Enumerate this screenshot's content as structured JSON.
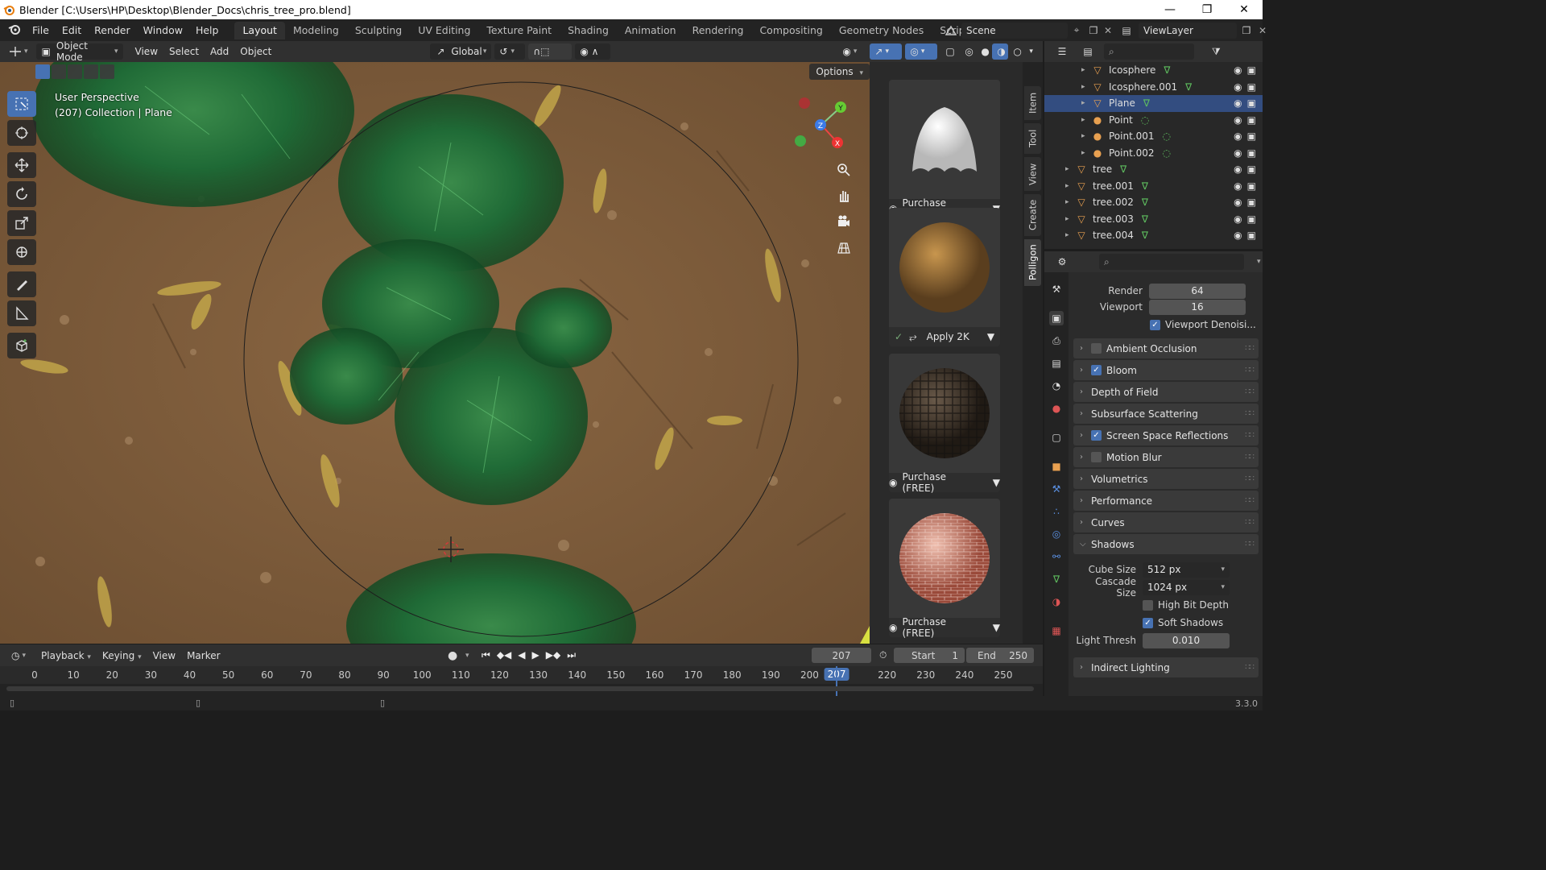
{
  "titlebar": {
    "title": "Blender [C:\\Users\\HP\\Desktop\\Blender_Docs\\chris_tree_pro.blend]",
    "minimize": "—",
    "maximize": "❐",
    "close": "✕"
  },
  "menu": [
    "File",
    "Edit",
    "Render",
    "Window",
    "Help"
  ],
  "workspaces": [
    "Layout",
    "Modeling",
    "Sculpting",
    "UV Editing",
    "Texture Paint",
    "Shading",
    "Animation",
    "Rendering",
    "Compositing",
    "Geometry Nodes",
    "Scripting",
    "+"
  ],
  "scene": {
    "scene_name": "Scene",
    "view_layer": "ViewLayer"
  },
  "viewport_header": {
    "mode": "Object Mode",
    "items": [
      "View",
      "Select",
      "Add",
      "Object"
    ],
    "orientation": "Global"
  },
  "viewport": {
    "perspective": "User Perspective",
    "collection": "(207) Collection | Plane",
    "options": "Options",
    "axes": {
      "x": "X",
      "y": "Y",
      "z": "Z"
    }
  },
  "assets": [
    {
      "action": "Purchase (FREE)",
      "kind": "cloth"
    },
    {
      "action": "Apply 2K",
      "kind": "dirt"
    },
    {
      "action": "Purchase (FREE)",
      "kind": "cobble"
    },
    {
      "action": "Purchase (FREE)",
      "kind": "brick"
    }
  ],
  "side_tabs": [
    "Item",
    "Tool",
    "View",
    "Create",
    "Polligon"
  ],
  "outliner": {
    "rows": [
      {
        "name": "Icosphere",
        "type": "mesh",
        "indent": 2,
        "selected": false
      },
      {
        "name": "Icosphere.001",
        "type": "mesh",
        "indent": 2,
        "selected": false
      },
      {
        "name": "Plane",
        "type": "mesh",
        "indent": 2,
        "selected": true
      },
      {
        "name": "Point",
        "type": "light",
        "indent": 2,
        "selected": false
      },
      {
        "name": "Point.001",
        "type": "light",
        "indent": 2,
        "selected": false
      },
      {
        "name": "Point.002",
        "type": "light",
        "indent": 2,
        "selected": false
      },
      {
        "name": "tree",
        "type": "mesh",
        "indent": 1,
        "selected": false
      },
      {
        "name": "tree.001",
        "type": "mesh",
        "indent": 1,
        "selected": false
      },
      {
        "name": "tree.002",
        "type": "mesh",
        "indent": 1,
        "selected": false
      },
      {
        "name": "tree.003",
        "type": "mesh",
        "indent": 1,
        "selected": false
      },
      {
        "name": "tree.004",
        "type": "mesh",
        "indent": 1,
        "selected": false
      }
    ]
  },
  "properties": {
    "render_label": "Render",
    "render_value": "64",
    "viewport_label": "Viewport",
    "viewport_value": "16",
    "denoise_label": "Viewport Denoisi...",
    "panels": [
      {
        "label": "Ambient Occlusion",
        "checkbox": true,
        "checked": false
      },
      {
        "label": "Bloom",
        "checkbox": true,
        "checked": true
      },
      {
        "label": "Depth of Field",
        "checkbox": false,
        "checked": false
      },
      {
        "label": "Subsurface Scattering",
        "checkbox": false,
        "checked": false
      },
      {
        "label": "Screen Space Reflections",
        "checkbox": true,
        "checked": true
      },
      {
        "label": "Motion Blur",
        "checkbox": true,
        "checked": false
      },
      {
        "label": "Volumetrics",
        "checkbox": false,
        "checked": false
      },
      {
        "label": "Performance",
        "checkbox": false,
        "checked": false
      },
      {
        "label": "Curves",
        "checkbox": false,
        "checked": false
      }
    ],
    "shadows": {
      "label": "Shadows",
      "cube_size_label": "Cube Size",
      "cube_size": "512 px",
      "cascade_size_label": "Cascade Size",
      "cascade_size": "1024 px",
      "high_bit_depth": "High Bit Depth",
      "soft_shadows": "Soft Shadows",
      "light_thresh_label": "Light Thresh",
      "light_thresh": "0.010"
    },
    "indirect": "Indirect Lighting"
  },
  "timeline": {
    "menus": [
      "Playback",
      "Keying",
      "View",
      "Marker"
    ],
    "current_frame": "207",
    "start_label": "Start",
    "start": "1",
    "end_label": "End",
    "end": "250",
    "ticks": [
      "0",
      "10",
      "20",
      "30",
      "40",
      "50",
      "60",
      "70",
      "80",
      "90",
      "100",
      "110",
      "120",
      "130",
      "140",
      "150",
      "160",
      "170",
      "180",
      "190",
      "200",
      "210",
      "220",
      "230",
      "240",
      "250"
    ],
    "cursor_label": "207"
  },
  "status": {
    "version": "3.3.0"
  },
  "colors": {
    "accent": "#4772b3",
    "mesh": "#e8a050",
    "data": "#5fbf5f",
    "light": "#5fbf5f"
  }
}
